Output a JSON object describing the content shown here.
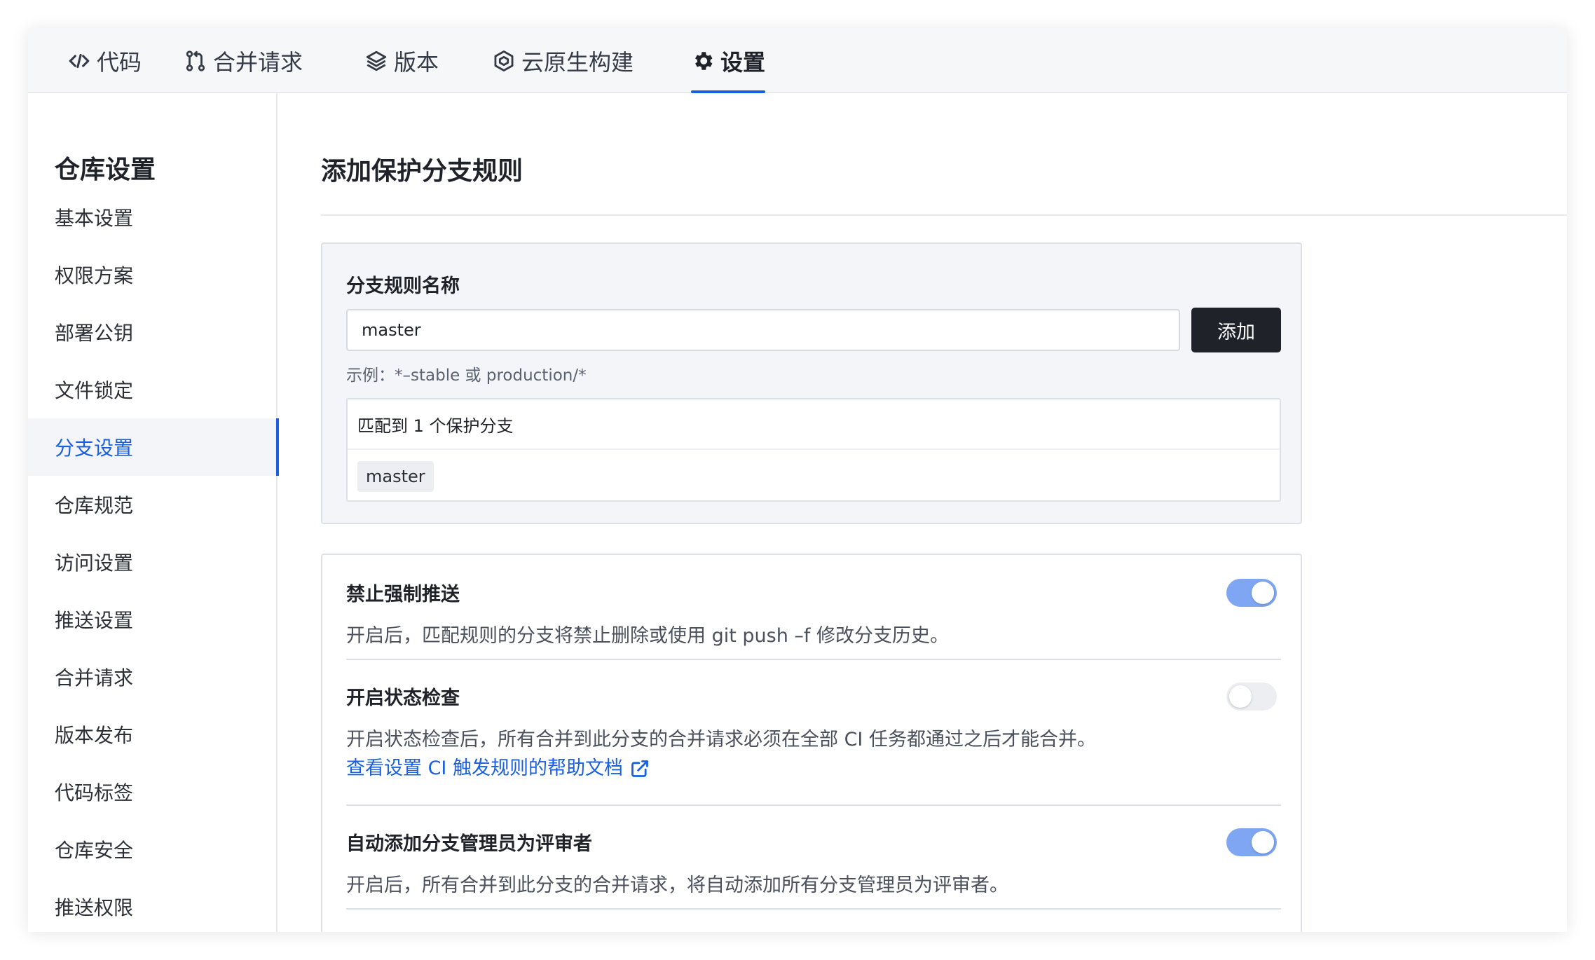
{
  "tabs": [
    {
      "label": "代码",
      "icon": "code-icon",
      "active": false
    },
    {
      "label": "合并请求",
      "icon": "merge-icon",
      "active": false
    },
    {
      "label": "版本",
      "icon": "layers-icon",
      "active": false
    },
    {
      "label": "云原生构建",
      "icon": "build-icon",
      "active": false
    },
    {
      "label": "设置",
      "icon": "gear-icon",
      "active": true
    }
  ],
  "sidebar": {
    "title": "仓库设置",
    "items": [
      {
        "label": "基本设置"
      },
      {
        "label": "权限方案"
      },
      {
        "label": "部署公钥"
      },
      {
        "label": "文件锁定"
      },
      {
        "label": "分支设置",
        "active": true
      },
      {
        "label": "仓库规范"
      },
      {
        "label": "访问设置"
      },
      {
        "label": "推送设置"
      },
      {
        "label": "合并请求"
      },
      {
        "label": "版本发布"
      },
      {
        "label": "代码标签"
      },
      {
        "label": "仓库安全"
      },
      {
        "label": "推送权限"
      }
    ]
  },
  "main": {
    "title": "添加保护分支规则",
    "rule": {
      "label": "分支规则名称",
      "input_value": "master",
      "add_label": "添加",
      "hint": "示例：*–stable 或 production/*",
      "match_text": "匹配到 1 个保护分支",
      "matched_branch": "master"
    },
    "options": [
      {
        "title": "禁止强制推送",
        "desc": "开启后，匹配规则的分支将禁止删除或使用 git push –f 修改分支历史。",
        "enabled": true
      },
      {
        "title": "开启状态检查",
        "desc": "开启状态检查后，所有合并到此分支的合并请求必须在全部 CI 任务都通过之后才能合并。",
        "link": "查看设置 CI 触发规则的帮助文档",
        "enabled": false
      },
      {
        "title": "自动添加分支管理员为评审者",
        "desc": "开启后，所有合并到此分支的合并请求，将自动添加所有分支管理员为评审者。",
        "enabled": true
      }
    ]
  },
  "colors": {
    "accent": "#1a5fe0",
    "toggle_on": "#7fa6f2",
    "button_dark": "#1f2329"
  }
}
